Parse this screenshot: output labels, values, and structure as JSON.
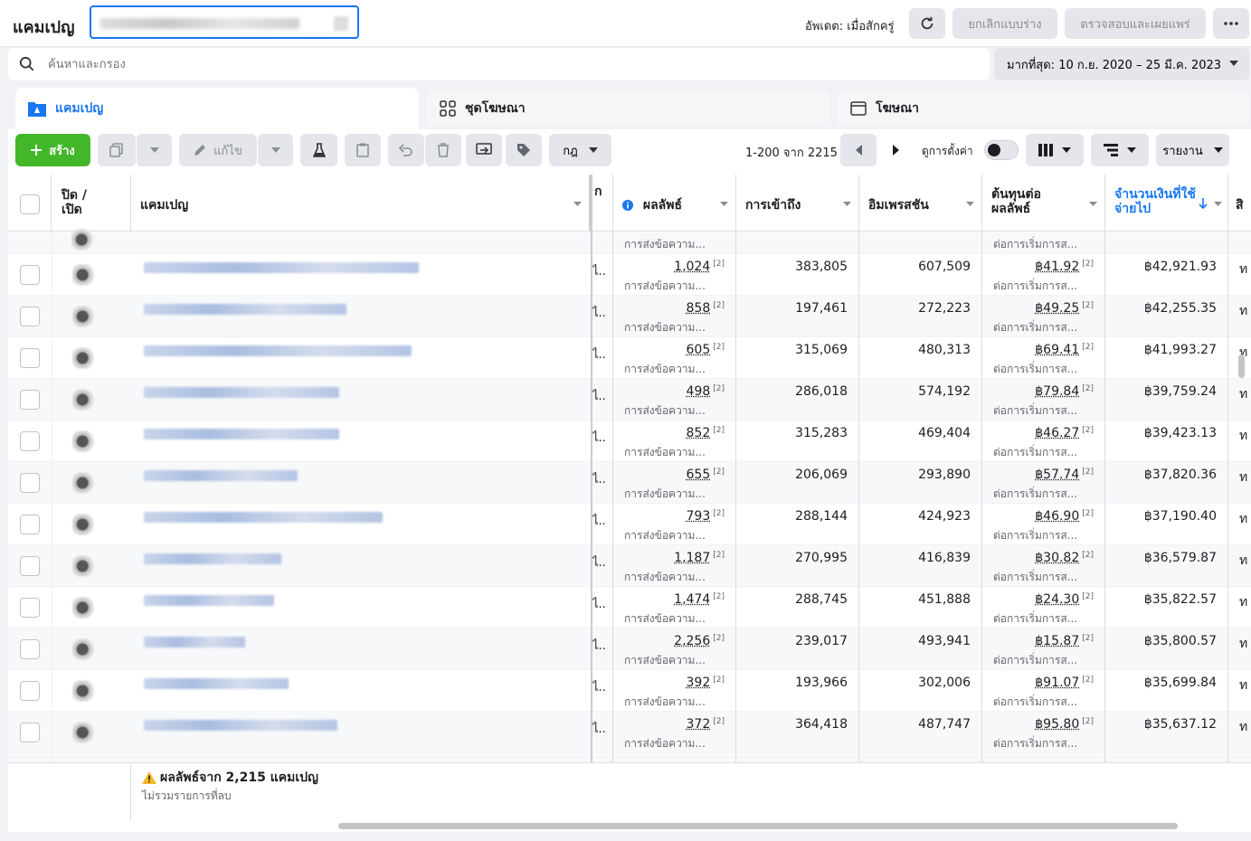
{
  "header": {
    "title": "แคมเปญ",
    "account_name": "",
    "updated_label": "อัพเดต: เมื่อสักครู่",
    "discard_label": "ยกเลิกแบบร่าง",
    "review_publish_label": "ตรวจสอบและเผยแพร่"
  },
  "search": {
    "placeholder": "ค้นหาและกรอง",
    "date_range": "มากที่สุด: 10 ก.ย. 2020 – 25 มี.ค. 2023"
  },
  "tabs": [
    {
      "label": "แคมเปญ"
    },
    {
      "label": "ชุดโฆษณา"
    },
    {
      "label": "โฆษณา"
    }
  ],
  "toolbar": {
    "create_label": "สร้าง",
    "edit_label": "แก้ไข",
    "rules_label": "กฎ",
    "pagination": "1-200 จาก 2215",
    "view_settings_label": "ดูการตั้งค่า",
    "report_label": "รายงาน"
  },
  "columns": {
    "onoff": "ปิด / เปิด",
    "campaign": "แคมเปญ",
    "bid_partial": "ก",
    "results": "ผลลัพธ์",
    "reach": "การเข้าถึง",
    "impressions": "อิมเพรสชัน",
    "cost_per_result": "ต้นทุนต่อผลลัพธ์",
    "amount_spent": "จำนวนเงินที่ใช้จ่ายไป",
    "next_partial": "สิ"
  },
  "row_labels": {
    "results_sub": "การส่งข้อความ...",
    "cost_sub": "ต่อการเริ่มการส...",
    "tag": "[2]",
    "bid_cut": "ไ..",
    "next_cut": "ท"
  },
  "rows": [
    {
      "results": "1,024",
      "reach": "383,805",
      "impressions": "607,509",
      "cost": "฿41.92",
      "spent": "฿42,921.93"
    },
    {
      "results": "858",
      "reach": "197,461",
      "impressions": "272,223",
      "cost": "฿49.25",
      "spent": "฿42,255.35"
    },
    {
      "results": "605",
      "reach": "315,069",
      "impressions": "480,313",
      "cost": "฿69.41",
      "spent": "฿41,993.27"
    },
    {
      "results": "498",
      "reach": "286,018",
      "impressions": "574,192",
      "cost": "฿79.84",
      "spent": "฿39,759.24"
    },
    {
      "results": "852",
      "reach": "315,283",
      "impressions": "469,404",
      "cost": "฿46.27",
      "spent": "฿39,423.13"
    },
    {
      "results": "655",
      "reach": "206,069",
      "impressions": "293,890",
      "cost": "฿57.74",
      "spent": "฿37,820.36"
    },
    {
      "results": "793",
      "reach": "288,144",
      "impressions": "424,923",
      "cost": "฿46.90",
      "spent": "฿37,190.40"
    },
    {
      "results": "1,187",
      "reach": "270,995",
      "impressions": "416,839",
      "cost": "฿30.82",
      "spent": "฿36,579.87"
    },
    {
      "results": "1,474",
      "reach": "288,745",
      "impressions": "451,888",
      "cost": "฿24.30",
      "spent": "฿35,822.57"
    },
    {
      "results": "2,256",
      "reach": "239,017",
      "impressions": "493,941",
      "cost": "฿15.87",
      "spent": "฿35,800.57"
    },
    {
      "results": "392",
      "reach": "193,966",
      "impressions": "302,006",
      "cost": "฿91.07",
      "spent": "฿35,699.84"
    },
    {
      "results": "372",
      "reach": "364,418",
      "impressions": "487,747",
      "cost": "฿95.80",
      "spent": "฿35,637.12"
    }
  ],
  "footer": {
    "summary": "ผลลัพธ์จาก 2,215 แคมเปญ",
    "note": "ไม่รวมรายการที่ลบ"
  },
  "colors": {
    "accent": "#1877f2",
    "create": "#42b72a"
  }
}
